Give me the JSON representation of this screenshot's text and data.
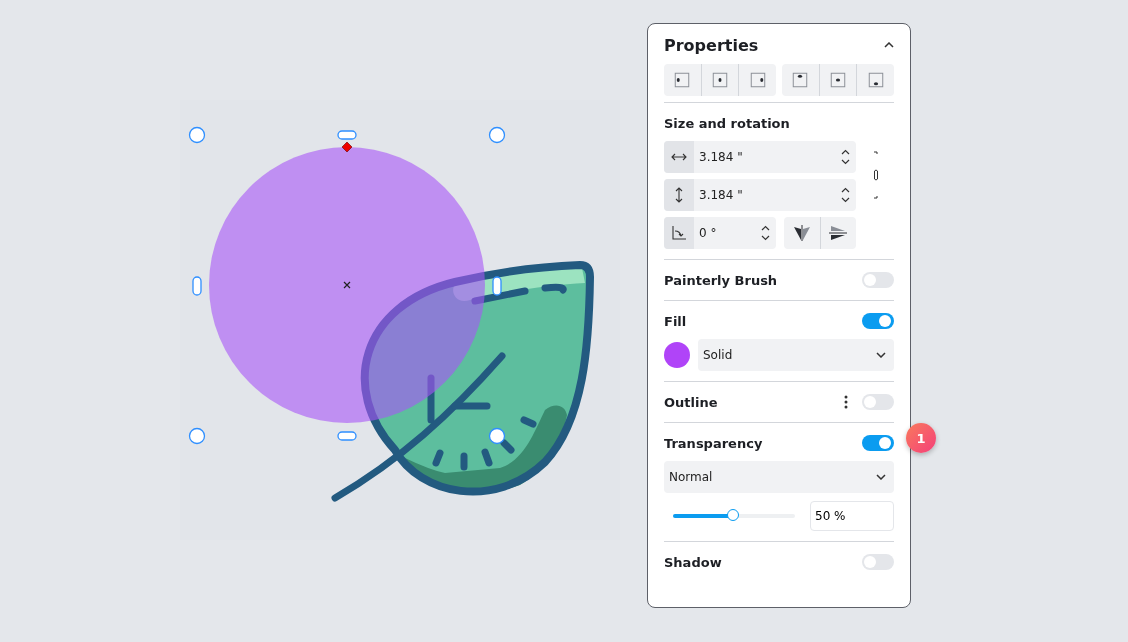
{
  "panel": {
    "title": "Properties",
    "expanded": true
  },
  "size_rotation": {
    "title": "Size and rotation",
    "width": "3.184 \"",
    "height": "3.184 \"",
    "angle": "0 °"
  },
  "sections": [
    {
      "kind": "toggle",
      "title": "Painterly Brush",
      "on": false
    },
    {
      "kind": "fill",
      "title": "Fill",
      "on": true,
      "color": "#b044f8",
      "mode": "Solid"
    },
    {
      "kind": "menu",
      "title": "Outline",
      "on": false
    },
    {
      "kind": "transparency",
      "title": "Transparency",
      "on": true,
      "mode": "Normal",
      "level": 0.5,
      "reading": "50 %",
      "badge": "1"
    },
    {
      "kind": "toggle",
      "title": "Shadow",
      "on": false
    }
  ]
}
